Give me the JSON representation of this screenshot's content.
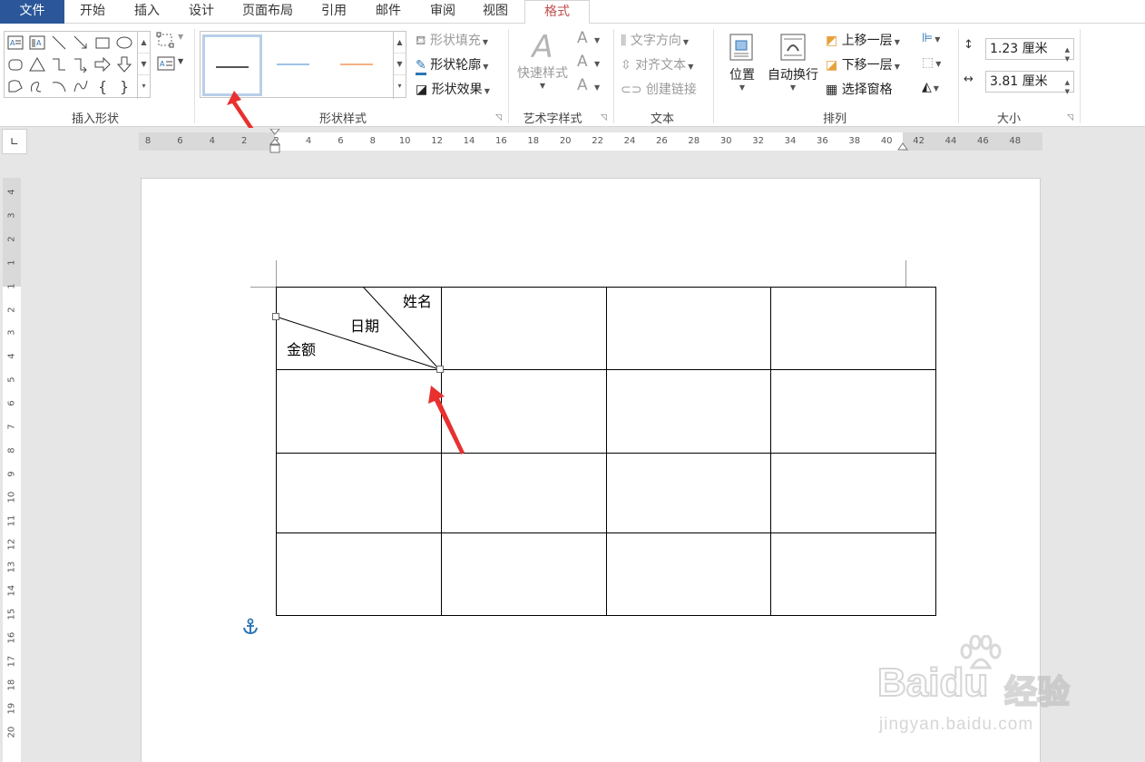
{
  "tabs": [
    {
      "label": "文件"
    },
    {
      "label": "开始"
    },
    {
      "label": "插入"
    },
    {
      "label": "设计"
    },
    {
      "label": "页面布局"
    },
    {
      "label": "引用"
    },
    {
      "label": "邮件"
    },
    {
      "label": "审阅"
    },
    {
      "label": "视图"
    },
    {
      "label": "格式"
    }
  ],
  "ribbon": {
    "insert_shapes": {
      "label": "插入形状"
    },
    "shape_styles": {
      "label": "形状样式",
      "fill": "形状填充",
      "outline": "形状轮廓",
      "effects": "形状效果"
    },
    "wordart": {
      "label": "艺术字样式",
      "quick_styles": "快速样式"
    },
    "text": {
      "label": "文本",
      "direction": "文字方向",
      "align": "对齐文本",
      "link": "创建链接"
    },
    "arrange": {
      "label": "排列",
      "position": "位置",
      "wrap": "自动换行",
      "bring_forward": "上移一层",
      "send_backward": "下移一层",
      "selection_pane": "选择窗格"
    },
    "size": {
      "label": "大小",
      "height": "1.23 厘米",
      "width": "3.81 厘米"
    }
  },
  "ruler": {
    "horizontal": [
      "8",
      "6",
      "4",
      "2",
      "2",
      "4",
      "6",
      "8",
      "10",
      "12",
      "14",
      "16",
      "18",
      "20",
      "22",
      "24",
      "26",
      "28",
      "30",
      "32",
      "34",
      "36",
      "38",
      "40",
      "42",
      "44",
      "46",
      "48"
    ],
    "vertical": [
      "4",
      "3",
      "2",
      "1",
      "1",
      "2",
      "3",
      "4",
      "5",
      "6",
      "7",
      "8",
      "9",
      "10",
      "11",
      "12",
      "13",
      "14",
      "15",
      "16",
      "17",
      "18",
      "19",
      "20"
    ]
  },
  "table": {
    "header_labels": {
      "top": "姓名",
      "middle": "日期",
      "bottom": "金额"
    },
    "rows": 4,
    "cols": 4
  },
  "watermark": {
    "brand": "Bai",
    "brand2": "du",
    "cn": "经验",
    "url": "jingyan.baidu.com"
  },
  "colors": {
    "file_tab": "#2b579a",
    "active_tab": "#c0504d",
    "arrow": "#e8302f",
    "outline_icon": "#2e75b6"
  }
}
